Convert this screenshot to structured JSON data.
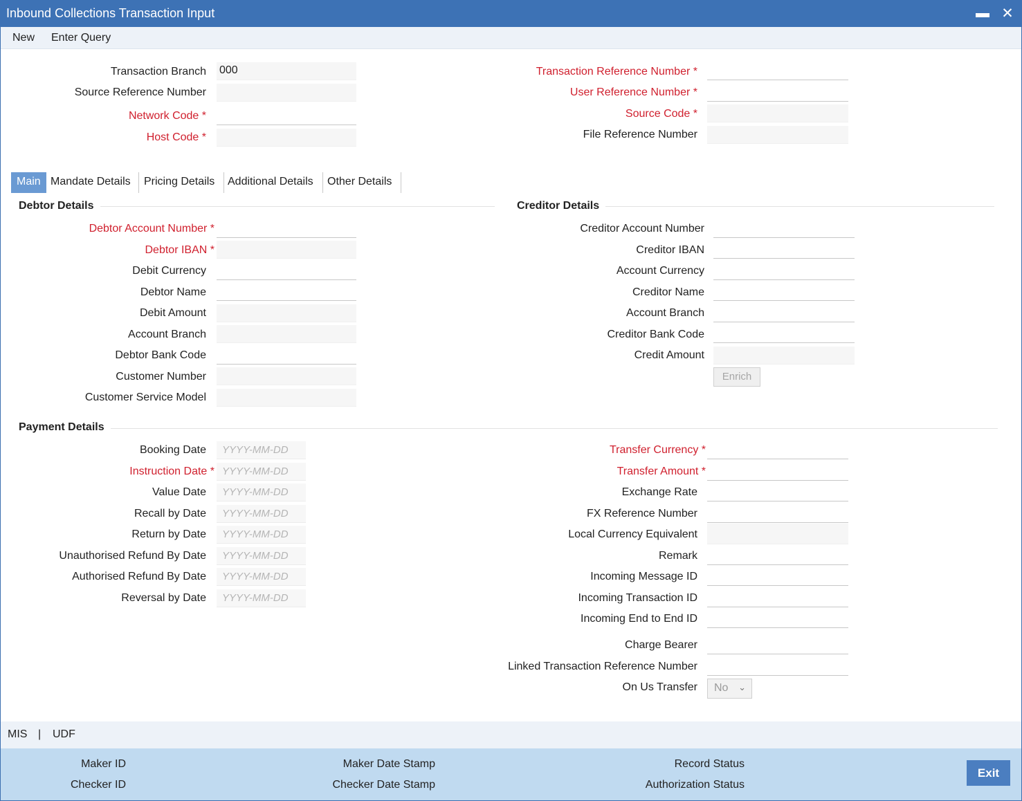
{
  "window": {
    "title": "Inbound Collections Transaction Input",
    "minimize_icon": "minimize-icon",
    "close_icon": "close-icon"
  },
  "menu": {
    "new": "New",
    "enter_query": "Enter Query"
  },
  "header": {
    "transaction_branch_label": "Transaction Branch",
    "transaction_branch_value": "000",
    "source_reference_number_label": "Source Reference Number",
    "network_code_label": "Network Code",
    "host_code_label": "Host Code",
    "transaction_reference_number_label": "Transaction Reference Number",
    "user_reference_number_label": "User Reference Number",
    "source_code_label": "Source Code",
    "file_reference_number_label": "File Reference Number"
  },
  "required_marker": "*",
  "tabs": [
    "Main",
    "Mandate Details",
    "Pricing Details",
    "Additional Details",
    "Other Details"
  ],
  "debtor": {
    "title": "Debtor Details",
    "account_number": "Debtor Account Number",
    "iban": "Debtor IBAN",
    "debit_currency": "Debit Currency",
    "debtor_name": "Debtor Name",
    "debit_amount": "Debit Amount",
    "account_branch": "Account Branch",
    "bank_code": "Debtor Bank Code",
    "customer_number": "Customer Number",
    "customer_service_model": "Customer Service Model"
  },
  "creditor": {
    "title": "Creditor Details",
    "account_number": "Creditor Account Number",
    "iban": "Creditor IBAN",
    "account_currency": "Account Currency",
    "creditor_name": "Creditor Name",
    "account_branch": "Account Branch",
    "bank_code": "Creditor Bank Code",
    "credit_amount": "Credit Amount",
    "enrich": "Enrich"
  },
  "payment": {
    "title": "Payment Details",
    "date_placeholder": "YYYY-MM-DD",
    "booking_date": "Booking Date",
    "instruction_date": "Instruction Date",
    "value_date": "Value Date",
    "recall_by_date": "Recall by Date",
    "return_by_date": "Return by Date",
    "unauthorised_refund_by_date": "Unauthorised Refund By Date",
    "authorised_refund_by_date": "Authorised Refund By Date",
    "reversal_by_date": "Reversal by Date",
    "transfer_currency": "Transfer Currency",
    "transfer_amount": "Transfer Amount",
    "exchange_rate": "Exchange Rate",
    "fx_reference_number": "FX Reference Number",
    "local_currency_equivalent": "Local Currency Equivalent",
    "remark": "Remark",
    "incoming_message_id": "Incoming Message ID",
    "incoming_transaction_id": "Incoming Transaction ID",
    "incoming_end_to_end_id": "Incoming End to End ID",
    "charge_bearer": "Charge Bearer",
    "linked_transaction_reference_number": "Linked Transaction Reference Number",
    "on_us_transfer": "On Us Transfer",
    "on_us_transfer_value": "No"
  },
  "links": {
    "mis": "MIS",
    "separator": "|",
    "udf": "UDF"
  },
  "footer": {
    "maker_id": "Maker ID",
    "checker_id": "Checker ID",
    "maker_date_stamp": "Maker Date Stamp",
    "checker_date_stamp": "Checker Date Stamp",
    "record_status": "Record Status",
    "authorization_status": "Authorization Status",
    "exit": "Exit"
  }
}
